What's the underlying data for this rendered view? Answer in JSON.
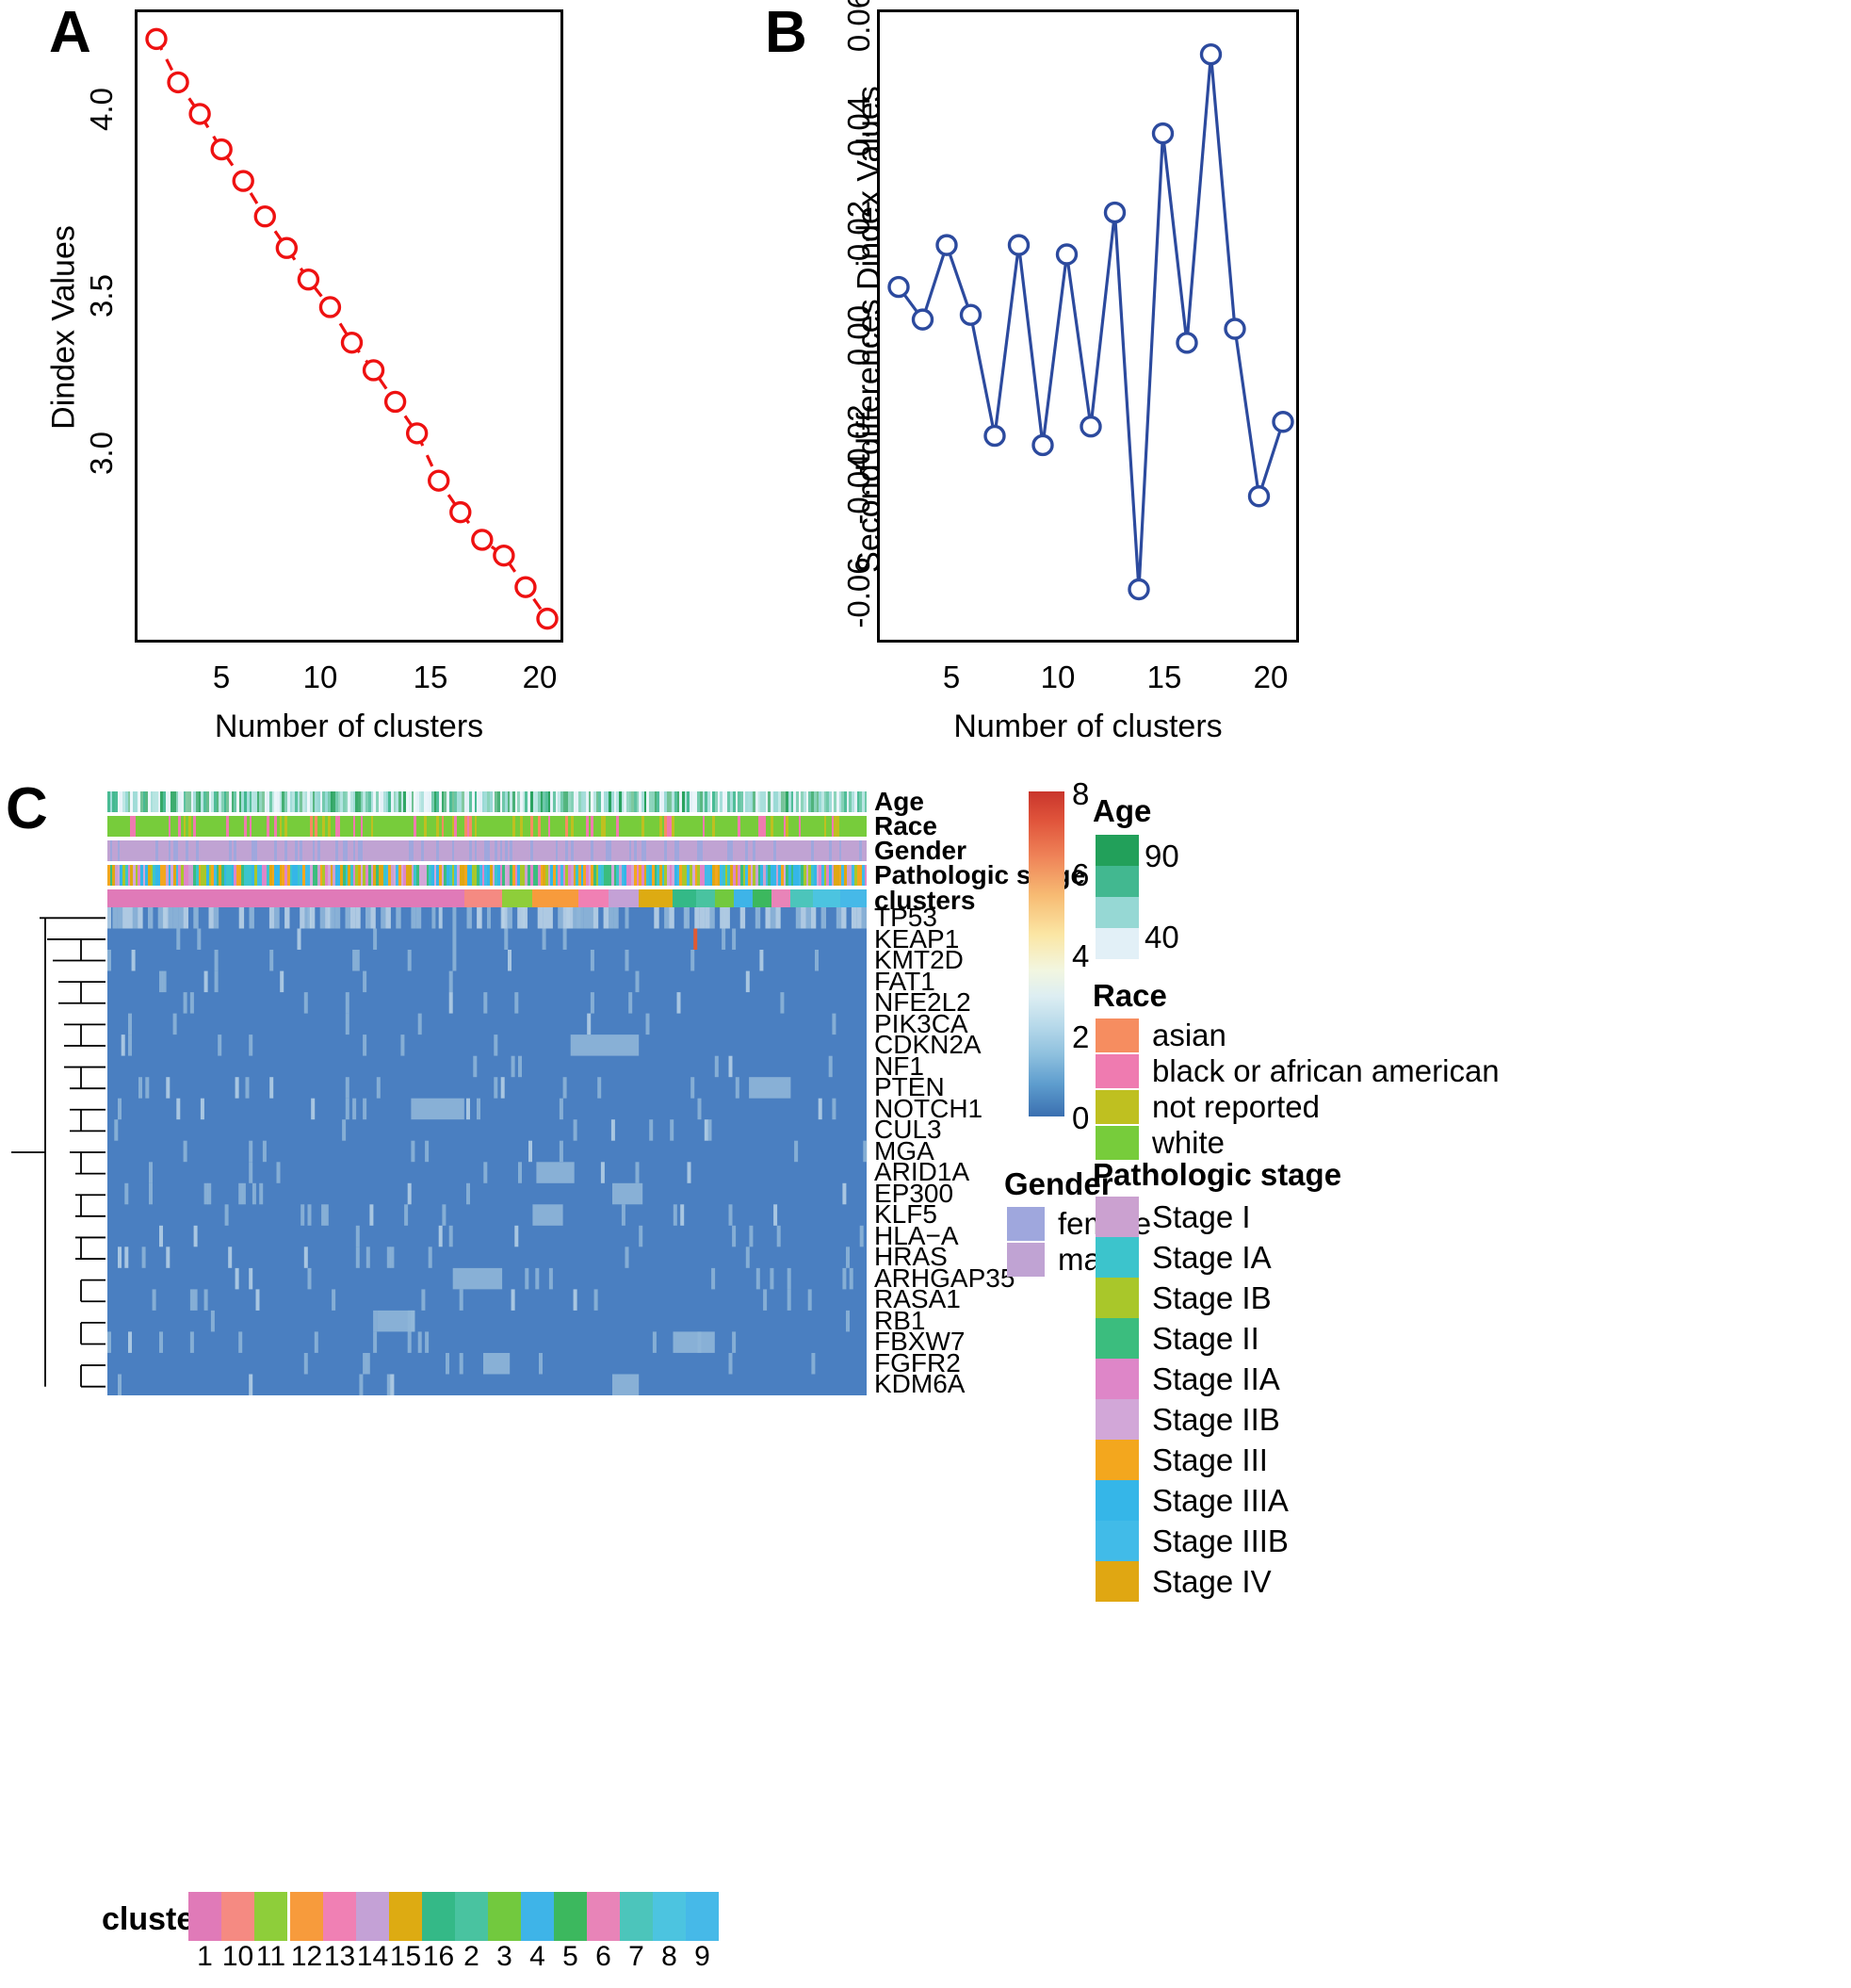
{
  "figure": {
    "panels": [
      "A",
      "B",
      "C"
    ]
  },
  "chart_data": [
    {
      "type": "line",
      "panel": "A",
      "title": "",
      "xlabel": "Number of clusters",
      "ylabel": "Dindex Values",
      "xlim": [
        2,
        20
      ],
      "ylim": [
        2.62,
        4.13
      ],
      "xticks": [
        5,
        10,
        15,
        20
      ],
      "yticks": [
        3.0,
        3.5,
        4.0
      ],
      "grid": false,
      "legend": "none",
      "marker": "open-circle",
      "linestyle": "dashed",
      "color": "#ee1111",
      "x": [
        2,
        3,
        4,
        5,
        6,
        7,
        8,
        9,
        10,
        11,
        12,
        13,
        14,
        15,
        16,
        17,
        18,
        19,
        20
      ],
      "values": [
        4.11,
        4.0,
        3.92,
        3.83,
        3.75,
        3.66,
        3.58,
        3.5,
        3.43,
        3.34,
        3.27,
        3.19,
        3.11,
        2.99,
        2.91,
        2.84,
        2.8,
        2.72,
        2.64
      ]
    },
    {
      "type": "line",
      "panel": "B",
      "title": "",
      "xlabel": "Number of clusters",
      "ylabel": "Second differences Dindex Values",
      "xlim": [
        3,
        19
      ],
      "ylim": [
        -0.066,
        0.062
      ],
      "xticks": [
        5,
        10,
        15,
        20
      ],
      "yticks": [
        -0.06,
        -0.04,
        -0.02,
        0.0,
        0.02,
        0.04,
        0.06
      ],
      "grid": false,
      "legend": "none",
      "marker": "open-circle",
      "linestyle": "solid",
      "color": "#2c4a9e",
      "x": [
        3,
        4,
        5,
        6,
        7,
        8,
        9,
        10,
        11,
        12,
        13,
        14,
        15,
        16,
        17,
        18,
        19
      ],
      "values": [
        0.007,
        0.0,
        0.016,
        0.001,
        -0.025,
        0.016,
        -0.027,
        0.014,
        -0.023,
        0.023,
        -0.058,
        0.04,
        -0.005,
        0.057,
        -0.002,
        -0.038,
        -0.022
      ]
    },
    {
      "type": "heatmap",
      "panel": "C",
      "title": "",
      "xlabel": "",
      "ylabel": "",
      "colorbar": {
        "ticks": [
          0,
          2,
          4,
          6,
          8
        ],
        "min": 0,
        "max": 8
      },
      "rows": [
        "TP53",
        "KEAP1",
        "KMT2D",
        "FAT1",
        "NFE2L2",
        "PIK3CA",
        "CDKN2A",
        "NF1",
        "PTEN",
        "NOTCH1",
        "CUL3",
        "MGA",
        "ARID1A",
        "EP300",
        "KLF5",
        "HLA−A",
        "HRAS",
        "ARHGAP35",
        "RASA1",
        "RB1",
        "FBXW7",
        "FGFR2",
        "KDM6A"
      ],
      "annotation_tracks": [
        "Age",
        "Race",
        "Gender",
        "Pathologic stage",
        "clusters"
      ]
    }
  ],
  "panelA": {
    "letter": "A",
    "ylabel": "Dindex Values",
    "xlabel": "Number of clusters",
    "yticks": [
      "3.0",
      "3.5",
      "4.0"
    ],
    "xticks": [
      "5",
      "10",
      "15",
      "20"
    ]
  },
  "panelB": {
    "letter": "B",
    "ylabel": "Second differences Dindex Values",
    "xlabel": "Number of clusters",
    "yticks": [
      "-0.06",
      "-0.04",
      "-0.02",
      "0.00",
      "0.02",
      "0.04",
      "0.06"
    ],
    "xticks": [
      "5",
      "10",
      "15",
      "20"
    ]
  },
  "panelC": {
    "letter": "C",
    "annotation_tracks": [
      {
        "label": "Age"
      },
      {
        "label": "Race"
      },
      {
        "label": "Gender"
      },
      {
        "label": "Pathologic stage"
      },
      {
        "label": "clusters"
      }
    ],
    "gene_rows": [
      "TP53",
      "KEAP1",
      "KMT2D",
      "FAT1",
      "NFE2L2",
      "PIK3CA",
      "CDKN2A",
      "NF1",
      "PTEN",
      "NOTCH1",
      "CUL3",
      "MGA",
      "ARID1A",
      "EP300",
      "KLF5",
      "HLA−A",
      "HRAS",
      "ARHGAP35",
      "RASA1",
      "RB1",
      "FBXW7",
      "FGFR2",
      "KDM6A"
    ],
    "colorbar": {
      "ticks": [
        "8",
        "6",
        "4",
        "2",
        "0"
      ]
    },
    "legend_age": {
      "title": "Age",
      "top_label": "90",
      "bottom_label": "40",
      "colors": [
        "#22a05a",
        "#42b890",
        "#96d8d4",
        "#e2f0f7"
      ]
    },
    "legend_race": {
      "title": "Race",
      "items": [
        {
          "label": "asian",
          "color": "#f68d60"
        },
        {
          "label": "black or african american",
          "color": "#ef7bb0"
        },
        {
          "label": "not reported",
          "color": "#bfc020"
        },
        {
          "label": "white",
          "color": "#77cc3b"
        }
      ]
    },
    "legend_gender": {
      "title": "Gender",
      "items": [
        {
          "label": "female",
          "color": "#9fa7dd"
        },
        {
          "label": "male",
          "color": "#c0a3d3"
        }
      ]
    },
    "legend_stage": {
      "title": "Pathologic stage",
      "items": [
        {
          "label": "Stage I",
          "color": "#cba1d0"
        },
        {
          "label": "Stage IA",
          "color": "#3cc4cc"
        },
        {
          "label": "Stage IB",
          "color": "#a9c72a"
        },
        {
          "label": "Stage II",
          "color": "#3bbd7e"
        },
        {
          "label": "Stage IIA",
          "color": "#de86c8"
        },
        {
          "label": "Stage IIB",
          "color": "#d2a7d8"
        },
        {
          "label": "Stage III",
          "color": "#f3a71e"
        },
        {
          "label": "Stage IIIA",
          "color": "#35b6e8"
        },
        {
          "label": "Stage IIIB",
          "color": "#41bbe8"
        },
        {
          "label": "Stage IV",
          "color": "#e0a712"
        }
      ]
    },
    "legend_clusters": {
      "title": "clusters",
      "items": [
        {
          "label": "1",
          "color": "#e07ab8"
        },
        {
          "label": "10",
          "color": "#f58a82"
        },
        {
          "label": "11",
          "color": "#8ece3a"
        },
        {
          "label": "12",
          "color": "#f79b3c"
        },
        {
          "label": "13",
          "color": "#f080b4"
        },
        {
          "label": "14",
          "color": "#c4a1d6"
        },
        {
          "label": "15",
          "color": "#ddab12"
        },
        {
          "label": "16",
          "color": "#34b987"
        },
        {
          "label": "2",
          "color": "#49c3a0"
        },
        {
          "label": "3",
          "color": "#72c93e"
        },
        {
          "label": "4",
          "color": "#3eb4e8"
        },
        {
          "label": "5",
          "color": "#3cb85e"
        },
        {
          "label": "6",
          "color": "#e884b8"
        },
        {
          "label": "7",
          "color": "#4cc5bb"
        },
        {
          "label": "8",
          "color": "#4cc4e0"
        },
        {
          "label": "9",
          "color": "#46b9e8"
        }
      ]
    }
  }
}
